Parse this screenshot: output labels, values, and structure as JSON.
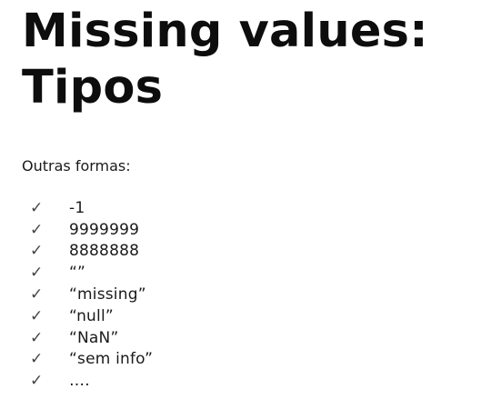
{
  "slide": {
    "title_line1": "Missing values:",
    "title_line2": "Tipos",
    "intro": "Outras formas:",
    "check_glyph": "✓",
    "items": [
      "-1",
      "9999999",
      "8888888",
      "“”",
      "“missing”",
      "“null”",
      "“NaN”",
      "“sem info”",
      "…."
    ]
  }
}
